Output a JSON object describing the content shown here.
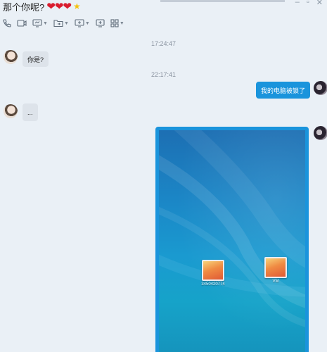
{
  "header": {
    "title": "那个你呢?",
    "hearts_icon": "broken-heart-icon",
    "hearts_count": 3,
    "star_icon": "star-icon",
    "accent_color": "#1a94dc"
  },
  "toolbar": {
    "items": [
      {
        "icon": "phone-icon",
        "has_dropdown": false
      },
      {
        "icon": "video-camera-icon",
        "has_dropdown": false
      },
      {
        "icon": "screen-share-icon",
        "has_dropdown": true
      },
      {
        "icon": "folder-icon",
        "has_dropdown": true
      },
      {
        "icon": "remote-desktop-icon",
        "has_dropdown": true
      },
      {
        "icon": "add-app-icon",
        "has_dropdown": false
      },
      {
        "icon": "grid-apps-icon",
        "has_dropdown": true
      }
    ]
  },
  "messages": [
    {
      "type": "timestamp",
      "text": "17:24:47"
    },
    {
      "type": "incoming",
      "text": "你是?"
    },
    {
      "type": "timestamp",
      "text": "22:17:41"
    },
    {
      "type": "outgoing",
      "text": "我的电脑被锁了"
    },
    {
      "type": "incoming",
      "text": "..."
    },
    {
      "type": "outgoing-image",
      "desktop_icons": [
        "3450420774",
        "VM"
      ]
    }
  ]
}
